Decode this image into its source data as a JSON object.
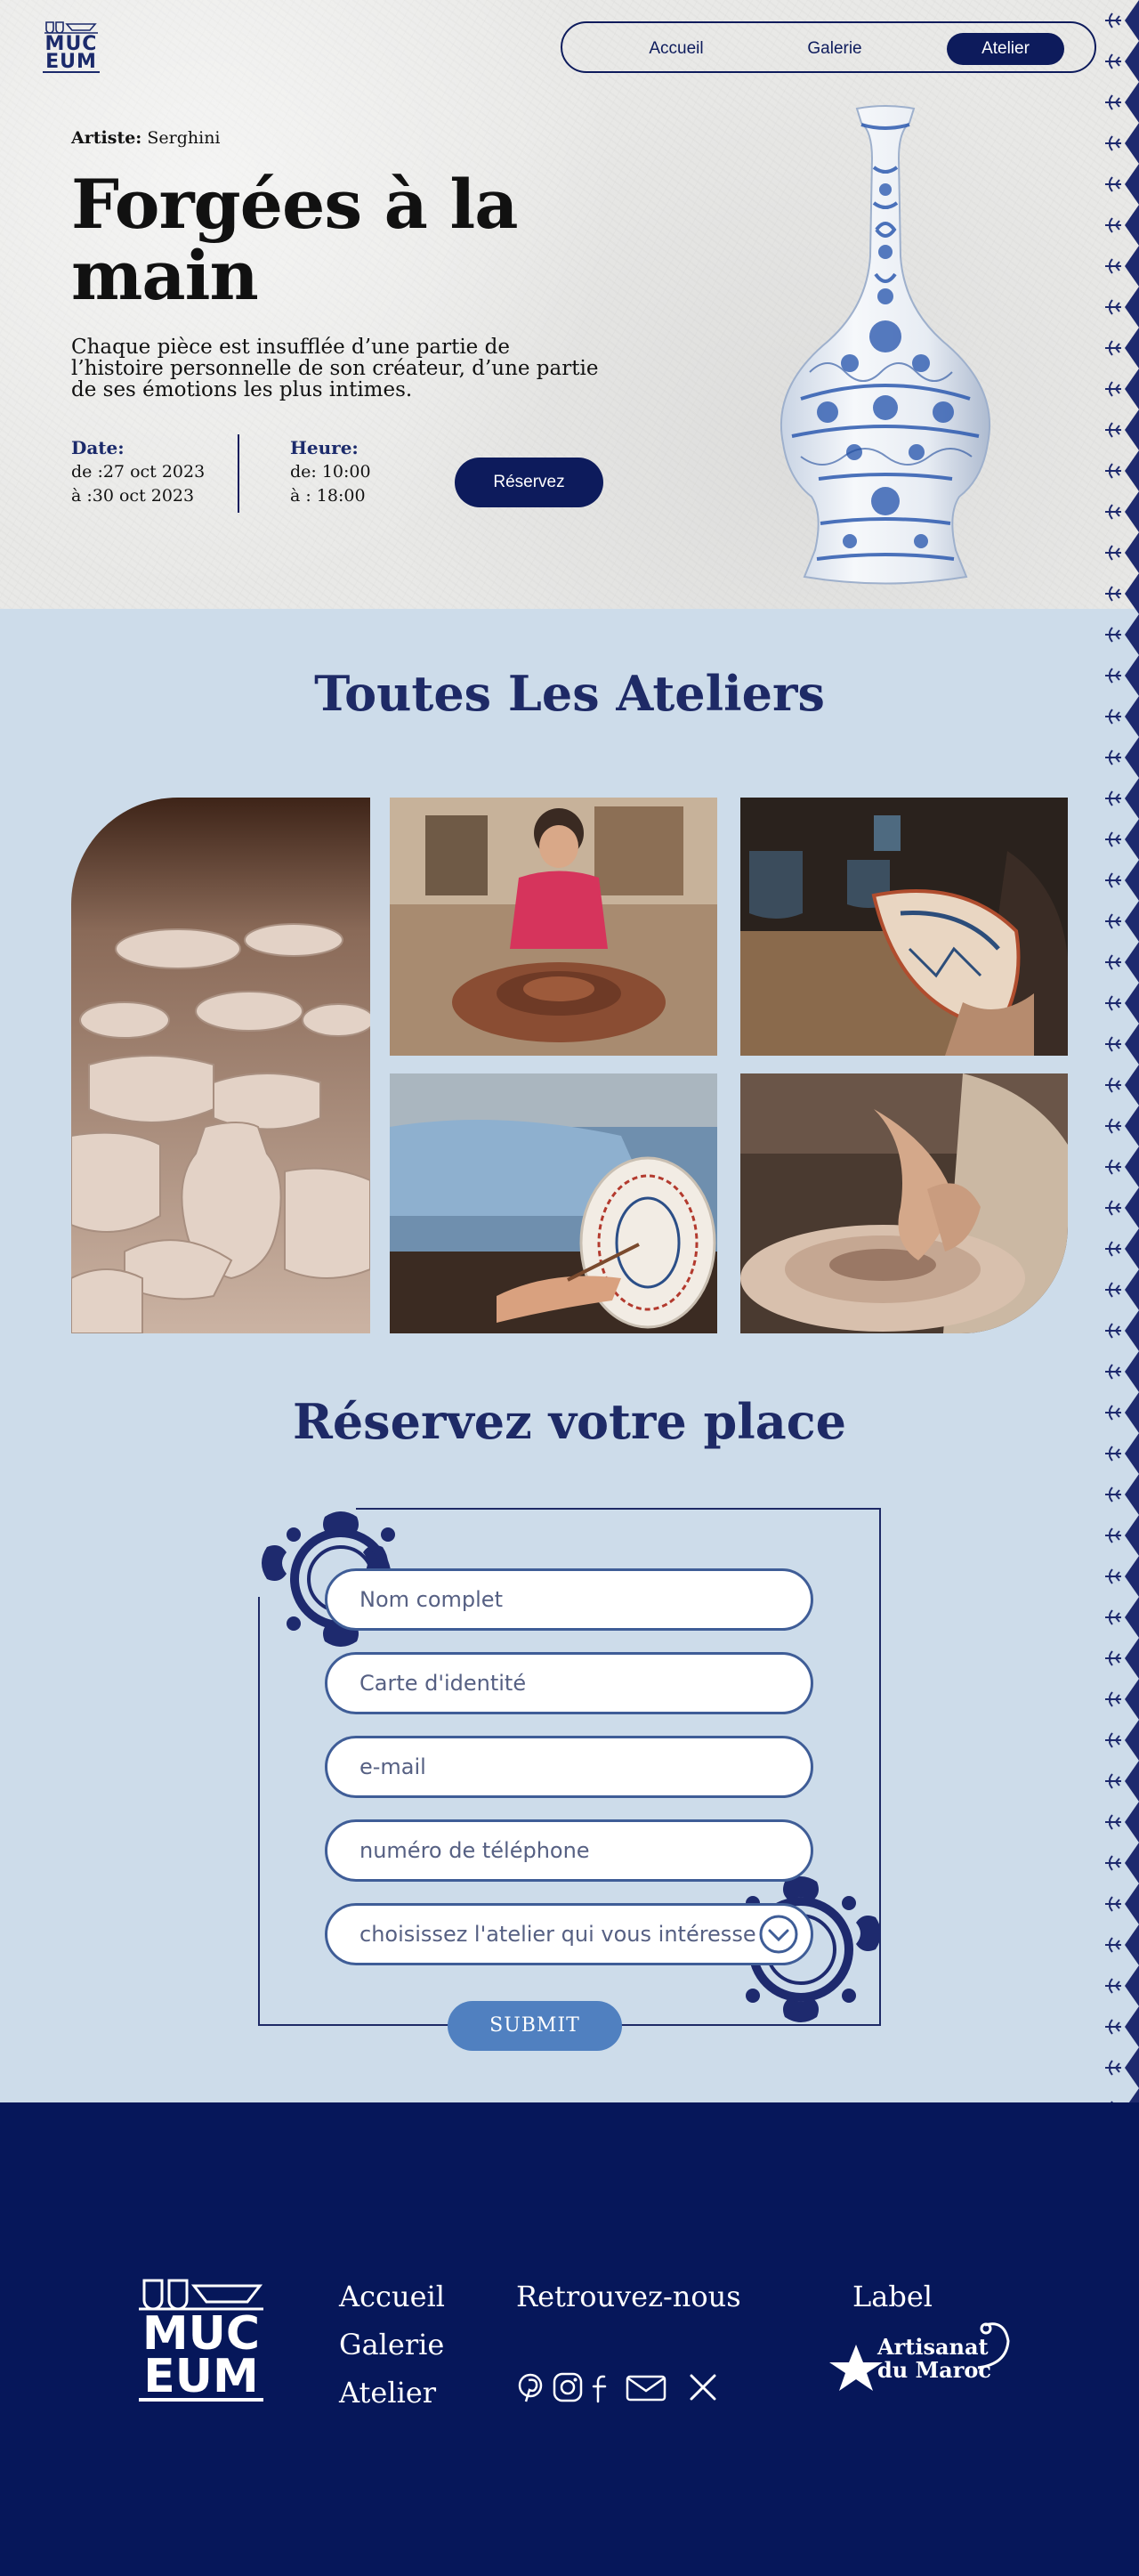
{
  "logo": {
    "line1": "MUC",
    "line2": "EUM"
  },
  "nav": {
    "items": [
      {
        "label": "Accueil"
      },
      {
        "label": "Galerie"
      },
      {
        "label": "Atelier"
      }
    ],
    "active": "Atelier"
  },
  "hero": {
    "artist_key": "Artiste:",
    "artist_name": "Serghini",
    "title": "Forgées à la main",
    "description": "Chaque pièce est insufflée d’une partie de l’histoire personnelle de son créateur, d’une partie de ses émotions les plus intimes.",
    "date": {
      "label": "Date:",
      "from": "de :27 oct 2023",
      "to": "à  :30 oct 2023"
    },
    "time": {
      "label": "Heure:",
      "from": "de: 10:00",
      "to": "à  :  18:00"
    },
    "reserve_button": "Réservez"
  },
  "workshops": {
    "title": "Toutes Les Ateliers",
    "images": [
      "pottery-collection-image",
      "child-pottery-wheel-image",
      "painted-plate-hand-image",
      "painting-plate-image",
      "throwing-bowl-image"
    ]
  },
  "booking": {
    "title": "Réservez votre place",
    "fields": [
      {
        "placeholder": "Nom complet"
      },
      {
        "placeholder": "Carte d'identité"
      },
      {
        "placeholder": "e-mail"
      },
      {
        "placeholder": "numéro de téléphone"
      },
      {
        "placeholder": "choisissez l'atelier qui vous intéresse"
      }
    ],
    "submit": "SUBMIT"
  },
  "footer": {
    "logo": {
      "line1": "MUC",
      "line2": "EUM"
    },
    "links": [
      "Accueil",
      "Galerie",
      "Atelier"
    ],
    "social_title": "Retrouvez-nous",
    "social_icons": [
      "pinterest-icon",
      "instagram-icon",
      "facebook-icon",
      "mail-icon",
      "x-icon"
    ],
    "label_title": "Label",
    "label_logo": {
      "line1": "Artisanat",
      "line2": "du Maroc"
    }
  },
  "colors": {
    "navy": "#0d1b5c",
    "footer": "#06175a",
    "section_bg": "#cddcea",
    "submit": "#5080c0",
    "title": "#1e2a66"
  }
}
